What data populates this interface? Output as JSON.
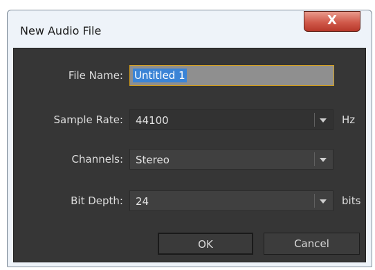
{
  "window": {
    "title": "New Audio File",
    "close_glyph": "X"
  },
  "form": {
    "file_name": {
      "label": "File Name:",
      "value": "Untitled 1"
    },
    "sample_rate": {
      "label": "Sample Rate:",
      "value": "44100",
      "unit": "Hz"
    },
    "channels": {
      "label": "Channels:",
      "value": "Stereo"
    },
    "bit_depth": {
      "label": "Bit Depth:",
      "value": "24",
      "unit": "bits"
    }
  },
  "buttons": {
    "ok": "OK",
    "cancel": "Cancel"
  },
  "icons": {
    "close": "close-icon",
    "dropdown": "chevron-down-icon"
  },
  "colors": {
    "dialog_background": "#363636",
    "selection": "#3b84d6",
    "focus_border": "#d4a020",
    "close_button": "#d0594a"
  }
}
